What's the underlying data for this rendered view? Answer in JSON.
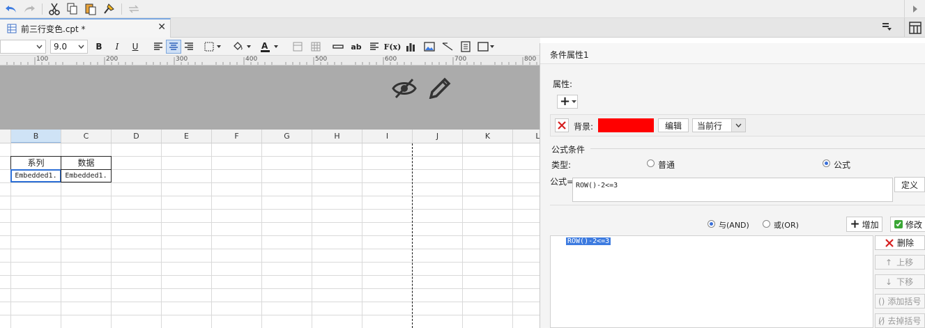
{
  "tab": {
    "title": "前三行变色.cpt *"
  },
  "format": {
    "font_size": "9.0",
    "bold": "B",
    "italic": "I",
    "underline": "U",
    "text_tool": "ab",
    "formula_tool": "F(x)"
  },
  "ruler": {
    "marks": [
      "100",
      "200",
      "300",
      "400",
      "500",
      "600",
      "700",
      "800"
    ]
  },
  "sheet": {
    "columns": [
      "B",
      "C",
      "D",
      "E",
      "F",
      "G",
      "H",
      "I",
      "J",
      "K",
      "L"
    ],
    "cells": {
      "b_header": "系列",
      "c_header": "数据",
      "b_value": "Embedded1.",
      "c_value": "Embedded1."
    }
  },
  "panel": {
    "title": "条件属性1",
    "attributes_label": "属性:",
    "add_symbol": "+",
    "bg_label": "背景:",
    "bg_color": "#ff0000",
    "edit_button": "编辑",
    "scope_select": "当前行",
    "formula_condition_label": "公式条件",
    "type_label": "类型:",
    "type_normal": "普通",
    "type_formula": "公式",
    "formula_label": "公式=",
    "formula_value": "ROW()-2<=3",
    "define_button": "定义",
    "and_label": "与(AND)",
    "or_label": "或(OR)",
    "add_button": "增加",
    "modify_button": "修改",
    "condition_item": "ROW()-2<=3",
    "delete_button": "删除",
    "move_up_button": "上移",
    "move_down_button": "下移",
    "add_bracket_button": "添加括号",
    "remove_bracket_button": "去掉括号"
  }
}
